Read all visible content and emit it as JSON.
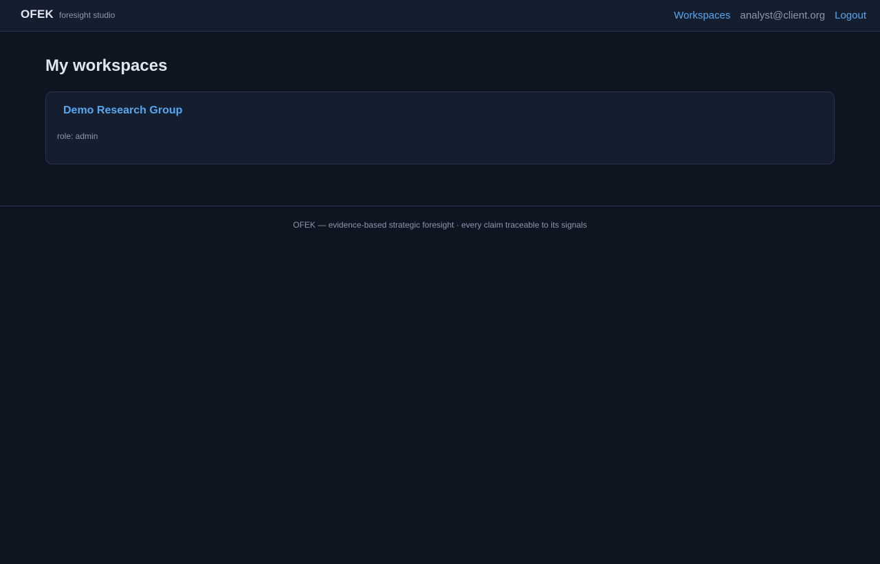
{
  "header": {
    "brand": "OFEK",
    "brand_subtitle": "foresight studio",
    "nav": {
      "workspaces_label": "Workspaces",
      "user_email": "analyst@client.org",
      "logout_label": "Logout"
    }
  },
  "main": {
    "title": "My workspaces",
    "workspaces": [
      {
        "name": "Demo Research Group",
        "role": "role: admin"
      }
    ]
  },
  "footer": {
    "text": "OFEK — evidence-based strategic foresight · every claim traceable to its signals"
  },
  "colors": {
    "background": "#0e1420",
    "panel": "#151e2f",
    "accent": "#58a6f0",
    "muted": "#8a98ad"
  }
}
